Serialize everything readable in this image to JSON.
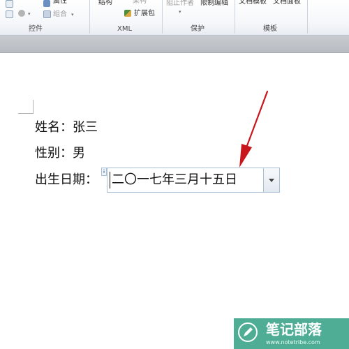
{
  "ribbon": {
    "controls_group": {
      "label": "控件",
      "properties_label": "属性",
      "group_label": "组合",
      "icons": [
        "checkbox-icon",
        "legacy-tools-icon",
        "group-icon",
        "properties-icon"
      ]
    },
    "xml_group": {
      "label": "XML",
      "structure_label": "结构",
      "schema_label": "架构",
      "expansion_pack_label": "扩展包"
    },
    "protect_group": {
      "label": "保护",
      "block_authors_label": "阻止作者",
      "restrict_editing_label": "限制编辑"
    },
    "templates_group": {
      "label": "模板",
      "document_template_label": "文档模板",
      "document_panel_label": "文档面板"
    }
  },
  "document": {
    "lines": {
      "name": "姓名：张三",
      "gender": "性别：男",
      "birth_label": "出生日期："
    },
    "date_control": {
      "value": "二〇一七年三月十五日"
    }
  },
  "annotation": {
    "arrow_color": "#c8161d"
  },
  "watermark": {
    "title": "笔记部落",
    "url": "www.notetribe.com",
    "color": "#1e9678"
  }
}
